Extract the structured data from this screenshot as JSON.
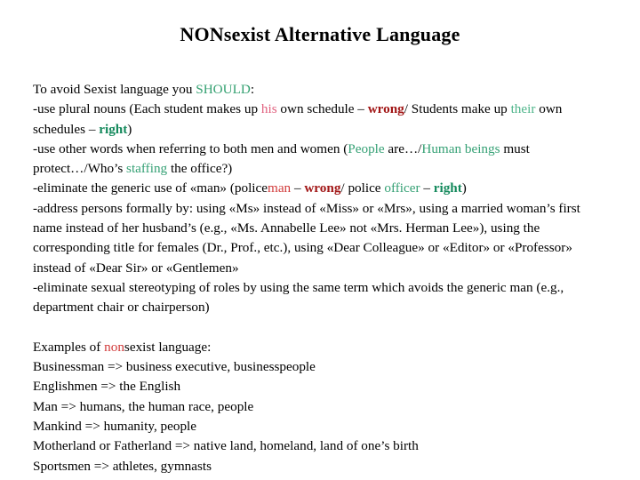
{
  "slide": {
    "title": "NONsexist Alternative Language",
    "background_color": "#ffffff",
    "text_color": "#000000"
  },
  "colors": {
    "should_green": "#33A070",
    "soft_red": "#E0607E",
    "red": "#D13A3A",
    "wrong_dark_red": "#A11616",
    "light_green": "#4DB489",
    "right_dark_green": "#14895C",
    "green": "#34A074"
  },
  "content": {
    "intro": {
      "lead": "To avoid Sexist language you ",
      "should": "SHOULD",
      "colon": ":"
    },
    "bullet_plural": {
      "p1": "-use plural nouns (Each student makes up ",
      "his": "his",
      "p2": " own schedule – ",
      "wrong": "wrong",
      "p3": "/ Students make up ",
      "their": "their",
      "p4": " own schedules – ",
      "right": "right",
      "p5": ")"
    },
    "bullet_other_words": {
      "p1": "-use other words when referring to both men and women (",
      "people": "People",
      "p2": " are…/",
      "human_beings": "Human beings",
      "p3": " must protect…/Who’s ",
      "staffing": "staffing",
      "p4": " the office?)"
    },
    "bullet_generic_man": {
      "p1": "-eliminate the generic use of «man» (police",
      "man": "man",
      "p2": " – ",
      "wrong": "wrong",
      "p3": "/ police ",
      "officer": "officer",
      "p4": " – ",
      "right": "right",
      "p5": ")"
    },
    "bullet_address": {
      "text": "-address persons formally by: using «Ms» instead of «Miss» or «Mrs», using a married woman’s first name instead of her husband’s (e.g., «Ms. Annabelle Lee» not «Mrs. Herman Lee»), using the corresponding title for females (Dr., Prof., etc.), using «Dear Colleague» or «Editor» or «Professor» instead of «Dear Sir» or «Gentlemen»"
    },
    "bullet_stereotyping": {
      "text": "-eliminate sexual stereotyping of roles by using the same term which avoids the generic man (e.g., department chair or chairperson)"
    },
    "examples_heading": {
      "p1": "Examples of ",
      "non": "non",
      "p2": "sexist language:"
    },
    "examples": [
      "Businessman => business executive, businesspeople",
      "Englishmen => the English",
      "Man => humans, the human race, people",
      "Mankind => humanity, people",
      "Motherland or Fatherland => native land, homeland, land of one’s birth",
      "Sportsmen => athletes, gymnasts"
    ]
  }
}
